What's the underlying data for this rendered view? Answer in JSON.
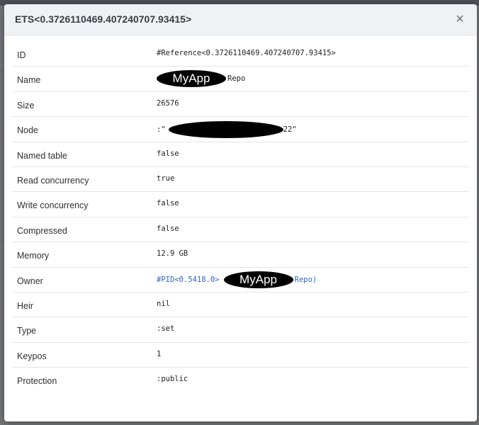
{
  "modal": {
    "title": "ETS<0.3726110469.407240707.93415>",
    "close_label": "×"
  },
  "rows": [
    {
      "label": "ID",
      "value": "#Reference<0.3726110469.407240707.93415>"
    },
    {
      "label": "Name",
      "badge": "MyApp",
      "value_suffix": "Repo"
    },
    {
      "label": "Size",
      "value": "26576"
    },
    {
      "label": "Node",
      "value_prefix": ":\"",
      "value_suffix": "22\""
    },
    {
      "label": "Named table",
      "value": "false"
    },
    {
      "label": "Read concurrency",
      "value": "true"
    },
    {
      "label": "Write concurrency",
      "value": "false"
    },
    {
      "label": "Compressed",
      "value": "false"
    },
    {
      "label": "Memory",
      "value": "12.9 GB"
    },
    {
      "label": "Owner",
      "link_prefix": "#PID<0.5418.0>",
      "badge": "MyApp",
      "link_suffix": "Repo)"
    },
    {
      "label": "Heir",
      "value": "nil"
    },
    {
      "label": "Type",
      "value": ":set"
    },
    {
      "label": "Keypos",
      "value": "1"
    },
    {
      "label": "Protection",
      "value": ":public"
    }
  ],
  "colors": {
    "link": "#2f65c8",
    "header_bg": "#f0f1f5",
    "overlay": "#727478"
  }
}
